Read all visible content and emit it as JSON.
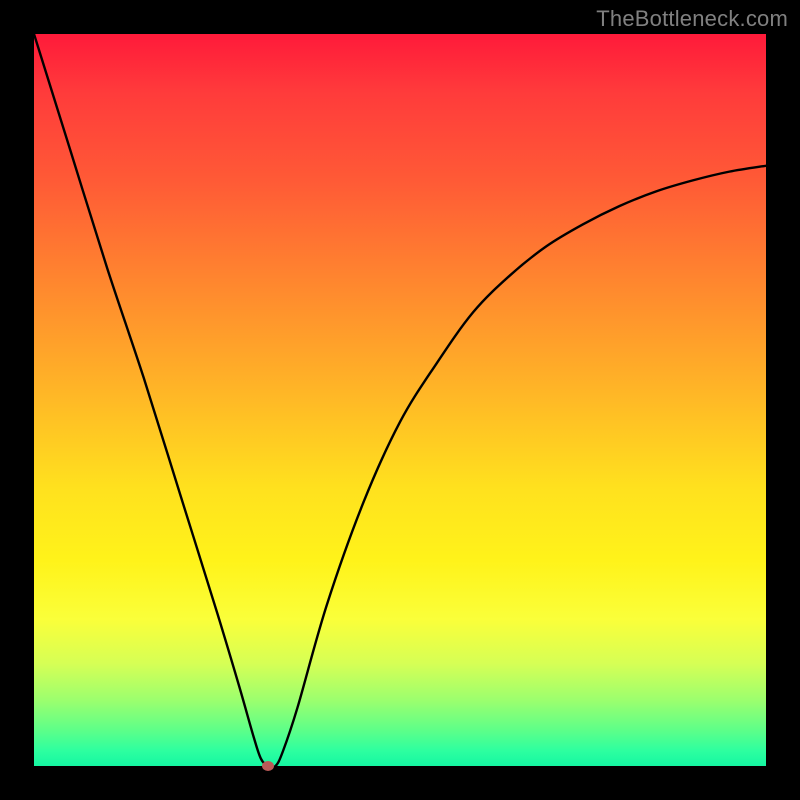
{
  "watermark": "TheBottleneck.com",
  "chart_data": {
    "type": "line",
    "title": "",
    "xlabel": "",
    "ylabel": "",
    "xlim": [
      0,
      100
    ],
    "ylim": [
      0,
      100
    ],
    "series": [
      {
        "name": "bottleneck-curve",
        "x": [
          0,
          5,
          10,
          15,
          20,
          25,
          28,
          30,
          31,
          32,
          33,
          34,
          36,
          40,
          45,
          50,
          55,
          60,
          65,
          70,
          75,
          80,
          85,
          90,
          95,
          100
        ],
        "y": [
          100,
          84,
          68,
          53,
          37,
          21,
          11,
          4,
          1,
          0,
          0,
          2,
          8,
          22,
          36,
          47,
          55,
          62,
          67,
          71,
          74,
          76.5,
          78.5,
          80,
          81.2,
          82
        ]
      }
    ],
    "marker": {
      "x": 32,
      "y": 0,
      "name": "optimal-point"
    },
    "gradient_stops": [
      {
        "pos": 0.0,
        "color": "#ff1a3a"
      },
      {
        "pos": 0.5,
        "color": "#ffe11e"
      },
      {
        "pos": 1.0,
        "color": "#15f7a2"
      }
    ]
  }
}
